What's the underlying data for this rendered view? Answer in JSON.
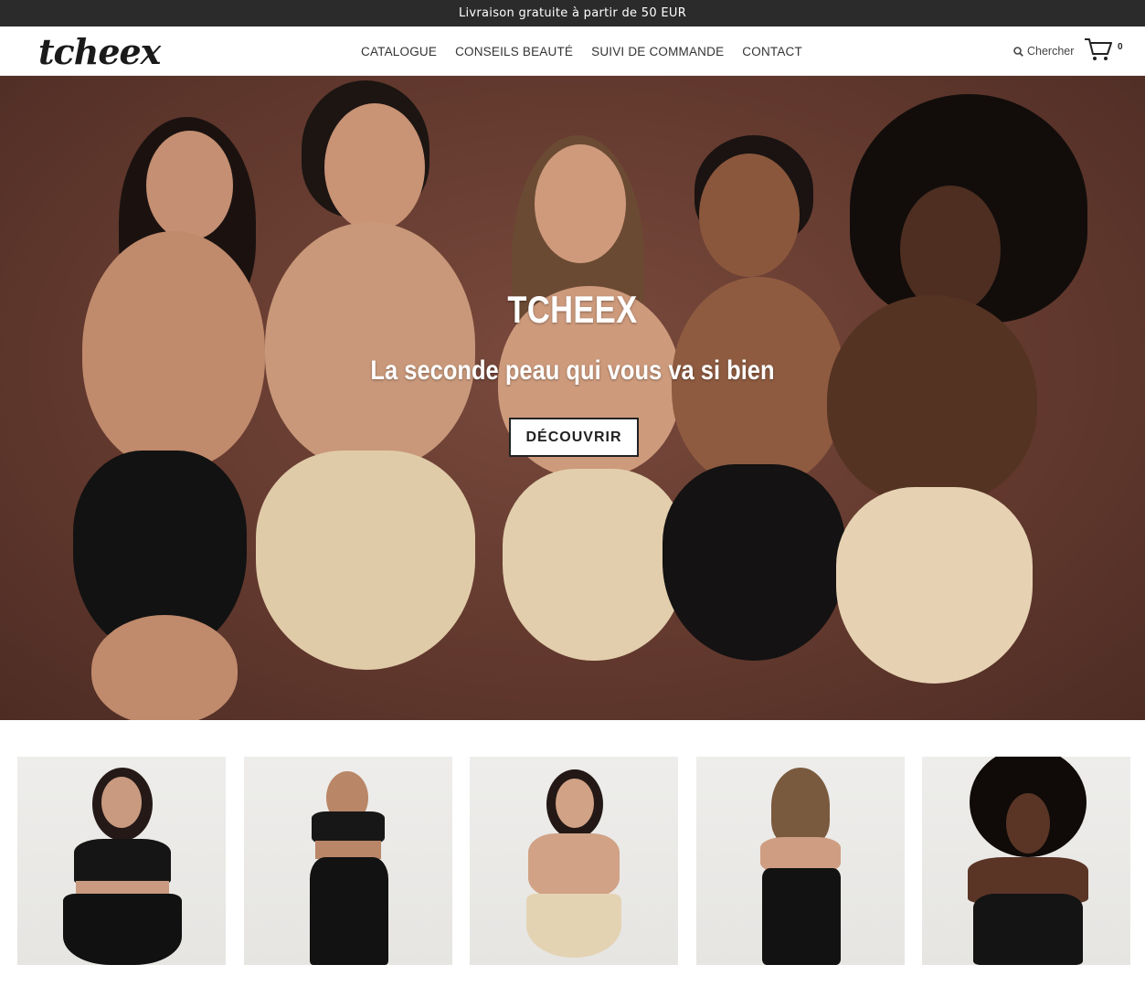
{
  "announcement": "Livraison gratuite à partir de 50 EUR",
  "header": {
    "logo": "tcheex",
    "nav": [
      "CATALOGUE",
      "CONSEILS BEAUTÉ",
      "SUIVI DE COMMANDE",
      "CONTACT"
    ],
    "search_label": "Chercher",
    "cart_count": "0"
  },
  "hero": {
    "title": "TCHEEX",
    "subtitle": "La seconde peau qui vous va si bien",
    "button": "DÉCOUVRIR"
  },
  "colors": {
    "announcement_bg": "#2b2b2b",
    "hero_bg": "#6b3e32",
    "button_border": "#222222"
  },
  "icons": [
    "search-icon",
    "cart-icon"
  ]
}
